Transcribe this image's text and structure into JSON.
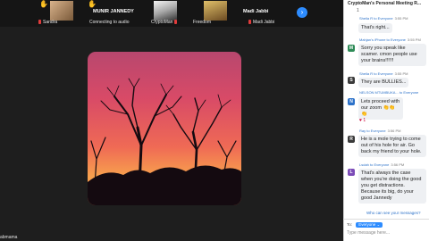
{
  "thumbnails": [
    {
      "name": "Sandra",
      "raised_hand": true
    },
    {
      "title": "MUNIR JANNEDY",
      "status": "Connecting to audio",
      "raised_hand": true
    },
    {
      "name": "CryptoMan",
      "raised_hand": false
    },
    {
      "name": "Freedom",
      "raised_hand": false
    },
    {
      "title": "Madi Jabbi",
      "name": "Madi Jabbi",
      "raised_hand": false
    }
  ],
  "bottom_name": "abmama",
  "chat": {
    "title": "CryptoMan's Personal Meeting R...",
    "controls": "1",
    "messages": [
      {
        "sender": "Sheila R to Everyone",
        "time": "3:55 PM",
        "text": "That's right...",
        "avatar": "S",
        "color": "#3a3a3a"
      },
      {
        "sender": "Mahjan's iPhone to Everyone",
        "time": "3:55 PM",
        "text": "Sorry you speak like scamer. cmon people use your brains!!!!!!",
        "avatar": "M",
        "color": "#2e8b57"
      },
      {
        "sender": "Sheila R to Everyone",
        "time": "3:55 PM",
        "text": "They are BULLIES...",
        "avatar": "S",
        "color": "#3a3a3a"
      },
      {
        "sender": "NELSON MTUMBUKA... to Everyone",
        "time": "",
        "text": "Lets proceed with our zoom 👏👏👏",
        "avatar": "N",
        "color": "#2d72c9"
      },
      {
        "sender": "Ray to Everyone",
        "time": "3:56 PM",
        "text": "He is a mole trying to come out of his hole for air. Go back my friend to your hole.",
        "avatar": "R",
        "color": "#3a3a3a"
      },
      {
        "sender": "Lsdah to Everyone",
        "time": "3:56 PM",
        "text": "That's always the case when you're doing the good you get distractions. Because its big, do your good Jannedy",
        "avatar": "L",
        "color": "#7b4bb7"
      }
    ],
    "reaction": "♥ 1",
    "who_can_see": "Who can see your messages?",
    "to_label": "To:",
    "to_value": "Everyone ⌄",
    "placeholder": "Type message here..."
  }
}
